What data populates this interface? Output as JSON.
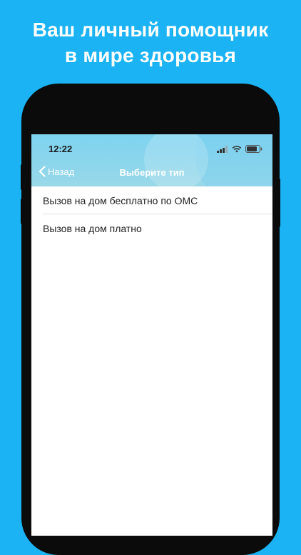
{
  "promo": {
    "line1": "Ваш личный помощник",
    "line2": "в мире здоровья"
  },
  "status_bar": {
    "time": "12:22",
    "icons": [
      "signal-icon",
      "wifi-icon",
      "battery-icon"
    ]
  },
  "nav": {
    "back_label": "Назад",
    "title": "Выберите тип"
  },
  "list": {
    "items": [
      {
        "label": "Вызов на дом бесплатно по ОМС"
      },
      {
        "label": "Вызов на дом платно"
      }
    ]
  },
  "colors": {
    "background": "#1bb3f3",
    "navbar": "#8dd6ec",
    "phone_frame": "#0b0b0c"
  }
}
